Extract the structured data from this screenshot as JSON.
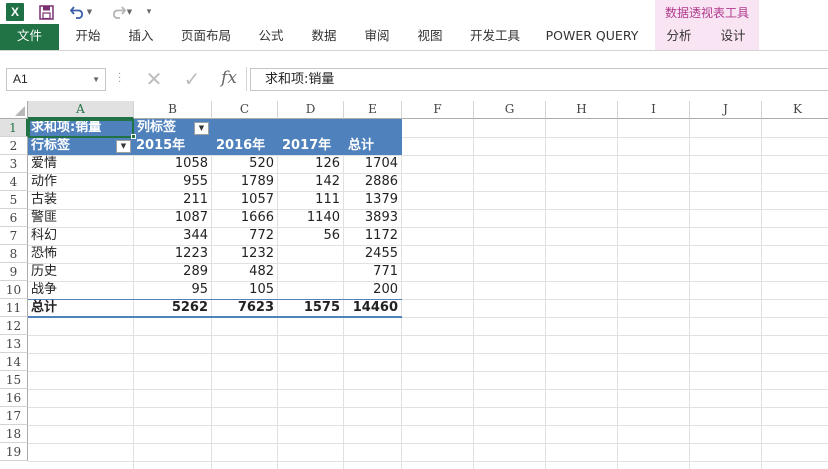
{
  "qat": {
    "app_logo": "X",
    "icons": [
      "excel-logo",
      "save-icon",
      "undo-icon",
      "redo-icon",
      "customize-icon"
    ]
  },
  "context_group": {
    "title": "数据透视表工具"
  },
  "tabs": [
    {
      "id": "file",
      "label": "文件"
    },
    {
      "id": "home",
      "label": "开始"
    },
    {
      "id": "insert",
      "label": "插入"
    },
    {
      "id": "page_layout",
      "label": "页面布局"
    },
    {
      "id": "formulas",
      "label": "公式"
    },
    {
      "id": "data",
      "label": "数据"
    },
    {
      "id": "review",
      "label": "审阅"
    },
    {
      "id": "view",
      "label": "视图"
    },
    {
      "id": "developer",
      "label": "开发工具"
    },
    {
      "id": "power_query",
      "label": "POWER QUERY"
    },
    {
      "id": "analyze",
      "label": "分析"
    },
    {
      "id": "design",
      "label": "设计"
    }
  ],
  "formula_bar": {
    "name_box": "A1",
    "cancel_glyph": "✕",
    "enter_glyph": "✓",
    "fx_label": "fx",
    "formula": "求和项:销量"
  },
  "columns": [
    "A",
    "B",
    "C",
    "D",
    "E",
    "F",
    "G",
    "H",
    "I",
    "J",
    "K"
  ],
  "rows": [
    "1",
    "2",
    "3",
    "4",
    "5",
    "6",
    "7",
    "8",
    "9",
    "10",
    "11",
    "12",
    "13",
    "14",
    "15",
    "16",
    "17",
    "18",
    "19"
  ],
  "pivot": {
    "value_field": "求和项:销量",
    "col_labels_caption": "列标签",
    "row_labels_caption": "行标签",
    "years": [
      "2015年",
      "2016年",
      "2017年"
    ],
    "total_caption": "总计",
    "rows": [
      {
        "label": "爱情",
        "y2015": "1058",
        "y2016": "520",
        "y2017": "126",
        "total": "1704"
      },
      {
        "label": "动作",
        "y2015": "955",
        "y2016": "1789",
        "y2017": "142",
        "total": "2886"
      },
      {
        "label": "古装",
        "y2015": "211",
        "y2016": "1057",
        "y2017": "111",
        "total": "1379"
      },
      {
        "label": "警匪",
        "y2015": "1087",
        "y2016": "1666",
        "y2017": "1140",
        "total": "3893"
      },
      {
        "label": "科幻",
        "y2015": "344",
        "y2016": "772",
        "y2017": "56",
        "total": "1172"
      },
      {
        "label": "恐怖",
        "y2015": "1223",
        "y2016": "1232",
        "y2017": "",
        "total": "2455"
      },
      {
        "label": "历史",
        "y2015": "289",
        "y2016": "482",
        "y2017": "",
        "total": "771"
      },
      {
        "label": "战争",
        "y2015": "95",
        "y2016": "105",
        "y2017": "",
        "total": "200"
      }
    ],
    "grand_total": {
      "label": "总计",
      "y2015": "5262",
      "y2016": "7623",
      "y2017": "1575",
      "total": "14460"
    }
  },
  "colors": {
    "accent": "#217346",
    "pivot_header": "#4f81bd",
    "context_tab": "#f8e4f2",
    "context_text": "#b03a8e"
  }
}
